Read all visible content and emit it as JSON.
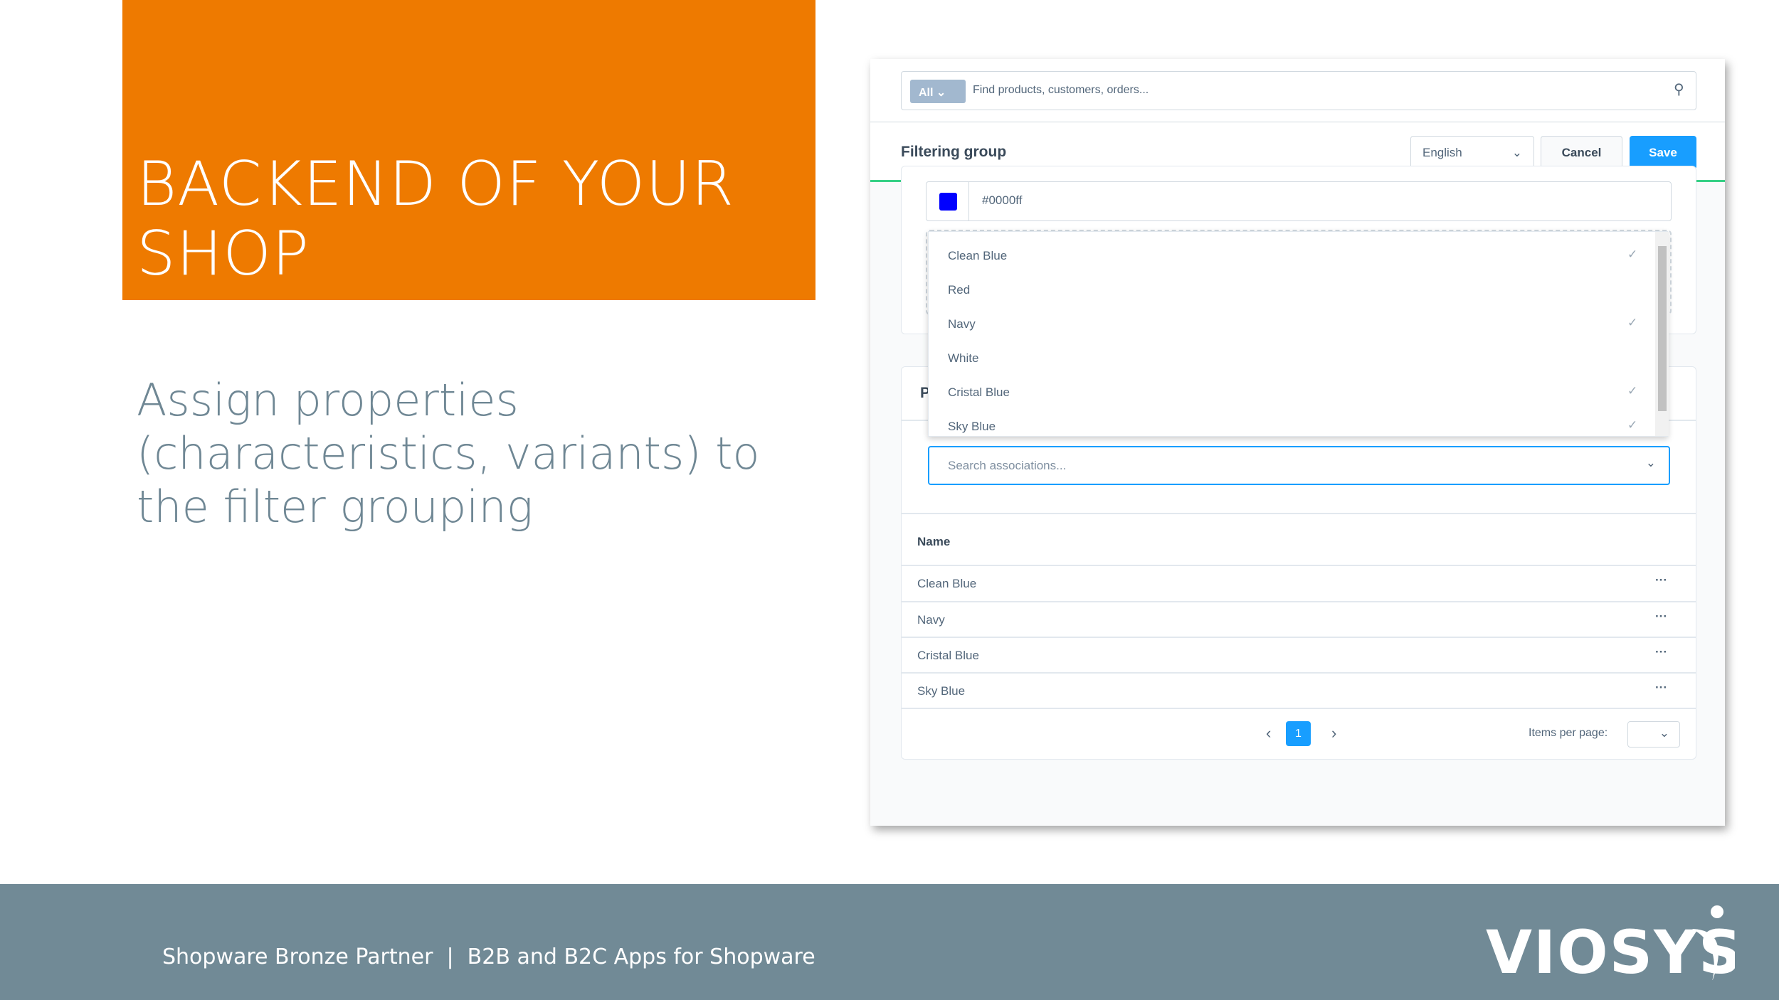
{
  "slide": {
    "title": "BACKEND OF YOUR SHOP",
    "subtitle": "Assign properties (characteristics, variants) to the filter grouping",
    "footer": "Shopware Bronze Partner  |  B2B and B2C Apps for Shopware",
    "logo": "VIOSYS",
    "brand_color": "#ee7a00",
    "footer_color": "#718a96"
  },
  "app": {
    "search": {
      "scope": "All",
      "placeholder": "Find products, customers, orders..."
    },
    "smartbar": {
      "title": "Filtering group",
      "language": "English",
      "cancel": "Cancel",
      "save": "Save"
    },
    "color": {
      "value": "#0000ff"
    },
    "properties": {
      "title_initial": "P",
      "search_placeholder": "Search associations...",
      "column": "Name",
      "rows": [
        {
          "name": "Clean Blue",
          "actions": "···"
        },
        {
          "name": "Navy",
          "actions": "···"
        },
        {
          "name": "Cristal Blue",
          "actions": "···"
        },
        {
          "name": "Sky Blue",
          "actions": "···"
        }
      ],
      "page": "1",
      "items_per_page_label": "Items per page:"
    },
    "dropdown": [
      {
        "label": "Clean Blue",
        "checked": true
      },
      {
        "label": "Red",
        "checked": false
      },
      {
        "label": "Navy",
        "checked": true
      },
      {
        "label": "White",
        "checked": false
      },
      {
        "label": "Cristal Blue",
        "checked": true
      },
      {
        "label": "Sky Blue",
        "checked": true
      }
    ]
  }
}
